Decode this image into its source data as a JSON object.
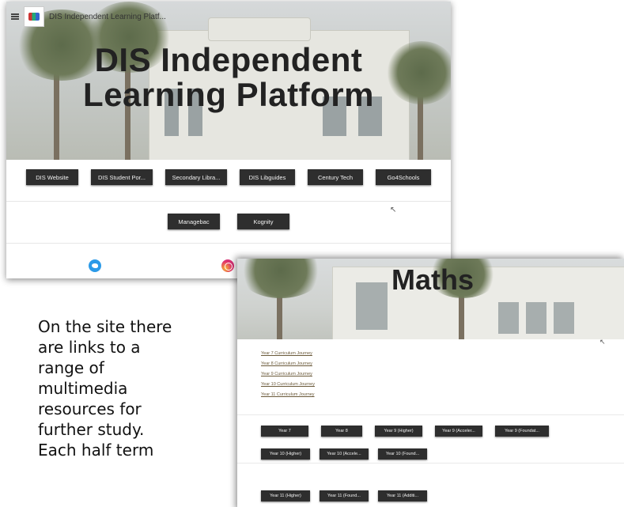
{
  "screenshot1": {
    "site_title": "DIS Independent Learning Platf...",
    "hero_title_line1": "DIS Independent",
    "hero_title_line2": "Learning Platform",
    "buttons_row1": [
      "DIS Website",
      "DIS Student Por...",
      "Secondary Libra...",
      "DIS Libguides",
      "Century Tech",
      "Go4Schools"
    ],
    "buttons_row2": [
      "Managebac",
      "Kognity"
    ],
    "social_icons": [
      "twitter-icon",
      "instagram-icon"
    ]
  },
  "screenshot2": {
    "page_title": "Maths",
    "curriculum_links": [
      "Year 7 Curriculum Journey",
      "Year 8 Curriculum Journey",
      "Year 9 Curriculum Journey",
      "Year 10 Curriculum Journey",
      "Year 11 Curriculum Journey"
    ],
    "year_buttons_row1": [
      "Year 7",
      "Year 8",
      "Year 9 (Higher)",
      "Year 9 (Acceler...",
      "Year 9 (Foundat..."
    ],
    "year_buttons_row2": [
      "Year 10 (Higher)",
      "Year 10 (Accele...",
      "Year 10 (Found..."
    ],
    "year_buttons_row3": [
      "Year 11 (Higher)",
      "Year 11 (Found...",
      "Year 11 (Additi..."
    ]
  },
  "caption_lines": [
    "On the site there",
    "are links to a",
    "range of",
    "multimedia",
    "resources for",
    "further study.",
    "Each half term"
  ]
}
